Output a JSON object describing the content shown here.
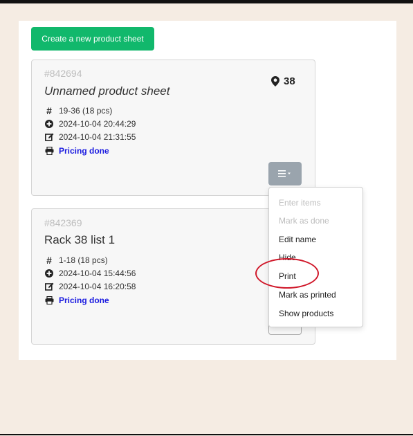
{
  "toolbar": {
    "create_label": "Create a new product sheet"
  },
  "cards": [
    {
      "id": "#842694",
      "name": "Unnamed product sheet",
      "location": "38",
      "range": "19-36 (18 pcs)",
      "created": "2024-10-04 20:44:29",
      "edited": "2024-10-04 21:31:55",
      "status": "Pricing done"
    },
    {
      "id": "#842369",
      "name": "Rack 38 list 1",
      "range": "1-18 (18 pcs)",
      "created": "2024-10-04 15:44:56",
      "edited": "2024-10-04 16:20:58",
      "status": "Pricing done"
    }
  ],
  "dropdown": {
    "items": [
      {
        "label": "Enter items",
        "disabled": true
      },
      {
        "label": "Mark as done",
        "disabled": true
      },
      {
        "label": "Edit name",
        "disabled": false
      },
      {
        "label": "Hide",
        "disabled": false
      },
      {
        "label": "Print",
        "disabled": false
      },
      {
        "label": "Mark as printed",
        "disabled": false
      },
      {
        "label": "Show products",
        "disabled": false
      }
    ]
  },
  "icons": {
    "location": "map-marker-icon",
    "range": "hash-icon",
    "created": "plus-circle-icon",
    "edited": "edit-icon",
    "status": "printer-icon",
    "menu": "hamburger-menu-icon"
  },
  "colors": {
    "accent": "#11b86c",
    "status_text": "#1a1ae0",
    "highlight": "#d0182a",
    "menu_button": "#9aa4ad"
  }
}
